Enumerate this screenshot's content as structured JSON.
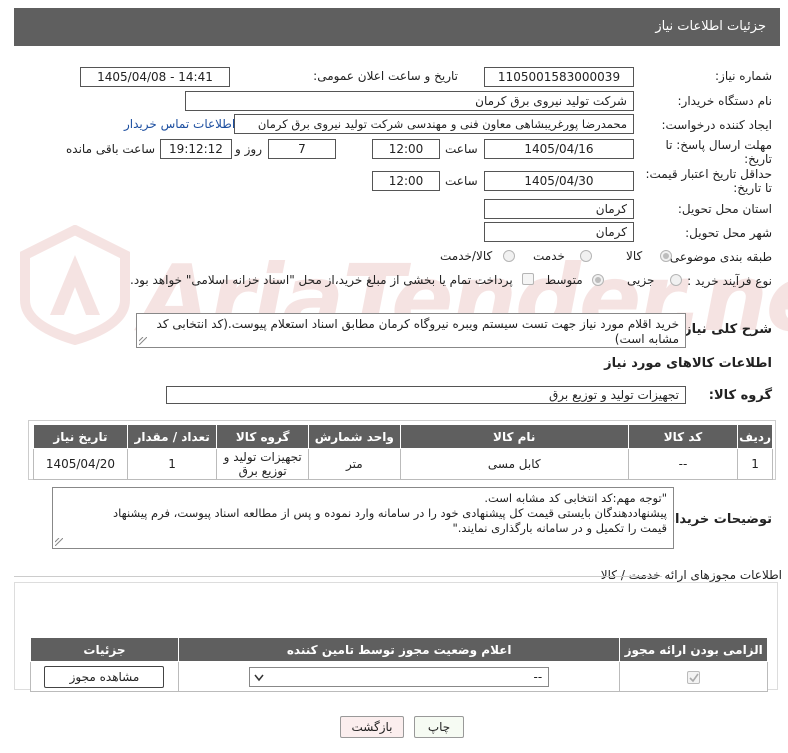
{
  "header": {
    "title": "جزئیات اطلاعات نیاز"
  },
  "need": {
    "number_label": "شماره نیاز:",
    "number": "1105001583000039",
    "announce_label": "تاریخ و ساعت اعلان عمومی:",
    "announce": "1405/04/08 - 14:41",
    "buyer_label": "نام دستگاه خریدار:",
    "buyer": "شرکت تولید نیروی برق کرمان",
    "creator_label": "ایجاد کننده درخواست:",
    "creator": "محمدرضا پورغریبشاهی معاون فنی و مهندسی  شرکت تولید نیروی برق کرمان",
    "contact_link": "اطلاعات تماس خریدار",
    "deadline_label_1": "مهلت ارسال پاسخ: تا",
    "deadline_label_2": "تاریخ:",
    "deadline_date": "1405/04/16",
    "time_label": "ساعت",
    "deadline_time": "12:00",
    "days": "7",
    "days_label": "روز و",
    "remaining": "19:12:12",
    "remaining_label": "ساعت باقی مانده",
    "validity_label_1": "حداقل تاریخ اعتبار قیمت:",
    "validity_label_2": "تا تاریخ:",
    "validity_date": "1405/04/30",
    "validity_time": "12:00",
    "province_label": "استان محل تحویل:",
    "province": "کرمان",
    "city_label": "شهر محل تحویل:",
    "city": "کرمان",
    "category_label": "طبقه بندی موضوعی:",
    "cat_goods": "کالا",
    "cat_service": "خدمت",
    "cat_both": "کالا/خدمت",
    "process_label": "نوع فرآیند خرید :",
    "proc_minor": "جزیی",
    "proc_medium": "متوسط",
    "payment_note": "پرداخت تمام یا بخشی از مبلغ خرید،از محل \"اسناد خزانه اسلامی\" خواهد بود."
  },
  "description": {
    "label": "شرح کلی نیاز:",
    "text": "خرید اقلام مورد نیاز جهت تست سیستم ویبره نیروگاه کرمان مطابق اسناد استعلام پیوست.(کد انتخابی کد مشابه است)"
  },
  "goods": {
    "section_title": "اطلاعات کالاهای مورد نیاز",
    "group_label": "گروه کالا:",
    "group": "تجهیزات تولید و توزیع برق",
    "columns": [
      "ردیف",
      "کد کالا",
      "نام کالا",
      "واحد شمارش",
      "گروه کالا",
      "تعداد / مقدار",
      "تاریخ نیاز"
    ],
    "rows": [
      [
        "1",
        "--",
        "کابل مسی",
        "متر",
        "تجهیزات تولید و توزیع برق",
        "1",
        "1405/04/20"
      ]
    ]
  },
  "buyer_notes": {
    "label": "توضیحات خریدار:",
    "line1": "\"توجه مهم:کد انتخابی کد مشابه است.",
    "line2": " پیشنهاددهندگان بایستی قیمت کل پیشنهادی خود را در سامانه وارد نموده و پس از مطالعه اسناد پیوست، فرم پیشنهاد",
    "line3": "قیمت را تکمیل و در سامانه بارگذاری نمایند.\""
  },
  "licenses": {
    "section_title": "اطلاعات مجوزهای ارائه خدمت / کالا",
    "columns": [
      "الزامی بودن ارائه مجوز",
      "اعلام وضعیت مجوز توسط تامین کننده",
      "جزئیات"
    ],
    "select_value": "--",
    "view_button": "مشاهده مجوز"
  },
  "actions": {
    "print": "چاپ",
    "back": "بازگشت"
  },
  "watermark": {
    "text": "AriaTender.net"
  }
}
